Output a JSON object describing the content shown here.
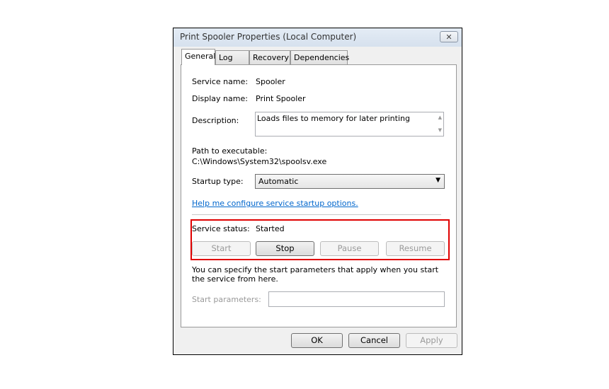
{
  "window": {
    "title": "Print Spooler Properties (Local Computer)",
    "close_icon": "close-icon"
  },
  "tabs": [
    {
      "label": "General",
      "active": true
    },
    {
      "label": "Log On"
    },
    {
      "label": "Recovery"
    },
    {
      "label": "Dependencies"
    }
  ],
  "general": {
    "service_name_label": "Service name:",
    "service_name": "Spooler",
    "display_name_label": "Display name:",
    "display_name": "Print Spooler",
    "description_label": "Description:",
    "description": "Loads files to memory for later printing",
    "path_label": "Path to executable:",
    "path": "C:\\Windows\\System32\\spoolsv.exe",
    "startup_type_label": "Startup type:",
    "startup_type": "Automatic",
    "help_link": "Help me configure service startup options.",
    "service_status_label": "Service status:",
    "service_status": "Started",
    "buttons": {
      "start": "Start",
      "stop": "Stop",
      "pause": "Pause",
      "resume": "Resume"
    },
    "start_params_info": "You can specify the start parameters that apply when you start the service from here.",
    "start_params_label": "Start parameters:",
    "start_params_value": ""
  },
  "footer": {
    "ok": "OK",
    "cancel": "Cancel",
    "apply": "Apply"
  },
  "colors": {
    "highlight": "#e00000",
    "link": "#0066cc"
  }
}
